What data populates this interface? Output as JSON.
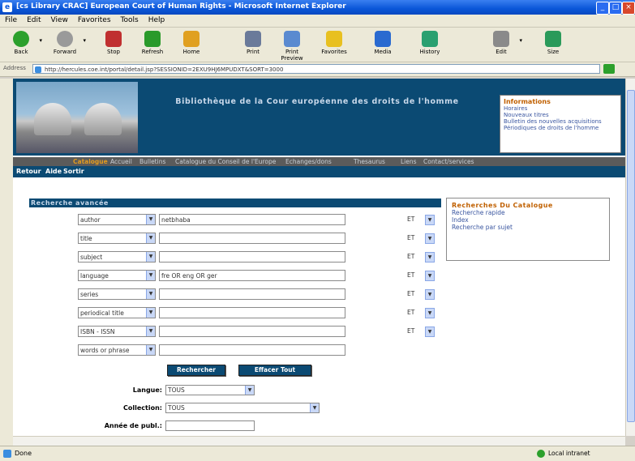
{
  "window": {
    "title": "[cs Library CRAC] European Court of Human Rights - Microsoft Internet Explorer"
  },
  "menu": [
    "File",
    "Edit",
    "View",
    "Favorites",
    "Tools",
    "Help"
  ],
  "toolbar": [
    {
      "label": "Back",
      "icon": "back-icon",
      "color": "#2ca02c"
    },
    {
      "label": "Forward",
      "icon": "forward-icon",
      "color": "#9a9a9a"
    },
    {
      "label": "Stop",
      "icon": "stop-icon",
      "color": "#c03030"
    },
    {
      "label": "Refresh",
      "icon": "refresh-icon",
      "color": "#2a9a2a"
    },
    {
      "label": "Home",
      "icon": "home-icon",
      "color": "#e0a020"
    },
    {
      "label": "Print",
      "icon": "print-icon",
      "color": "#6a7a9a"
    },
    {
      "label": "Print Preview",
      "icon": "print-preview-icon",
      "color": "#5a8ad0"
    },
    {
      "label": "Favorites",
      "icon": "favorites-icon",
      "color": "#e8c020"
    },
    {
      "label": "Media",
      "icon": "media-icon",
      "color": "#2a6ad0"
    },
    {
      "label": "History",
      "icon": "history-icon",
      "color": "#2aa070"
    },
    {
      "label": "Edit",
      "icon": "edit-icon",
      "color": "#8a8a8a"
    },
    {
      "label": "Size",
      "icon": "size-icon",
      "color": "#2a9a5a"
    }
  ],
  "address": {
    "label": "Address",
    "url": "http://hercules.coe.int/portal/detail.jsp?SESSIONID=2EXU9HJ6MPUDXT&SORT=3000"
  },
  "banner": {
    "title": "Bibliothèque de la Cour européenne des droits de l'homme",
    "info_heading": "Informations",
    "info_links": [
      "Horaires",
      "Nouveaux titres",
      "Bulletin des nouvelles acquisitions",
      "Périodiques de droits de l'homme"
    ]
  },
  "nav": {
    "items": [
      "Catalogue",
      "Accueil",
      "Bulletins",
      "Catalogue du Conseil de l'Europe",
      "Echanges/dons",
      "Thesaurus",
      "Liens",
      "Contact/services"
    ],
    "active": "Catalogue"
  },
  "subnav": [
    "Retour",
    "Aide",
    "Sortir"
  ],
  "search": {
    "heading": "Recherche avancée",
    "rows": [
      {
        "field": "author",
        "value": "netbhaba",
        "op": "ET"
      },
      {
        "field": "title",
        "value": "",
        "op": "ET"
      },
      {
        "field": "subject",
        "value": "",
        "op": "ET"
      },
      {
        "field": "language",
        "value": "fre OR eng OR ger",
        "op": "ET"
      },
      {
        "field": "series",
        "value": "",
        "op": "ET"
      },
      {
        "field": "periodical title",
        "value": "",
        "op": "ET"
      },
      {
        "field": "ISBN - ISSN",
        "value": "",
        "op": "ET"
      },
      {
        "field": "words or phrase",
        "value": "",
        "op": ""
      }
    ],
    "search_button": "Rechercher",
    "clear_button": "Effacer Tout",
    "language_label": "Langue:",
    "language_value": "TOUS",
    "collection_label": "Collection:",
    "collection_value": "TOUS",
    "year_label": "Année de publ.:",
    "year_value": ""
  },
  "catalog_box": {
    "heading": "Recherches Du Catalogue",
    "links": [
      "Recherche rapide",
      "Index",
      "Recherche par sujet"
    ]
  },
  "status": {
    "text": "Done",
    "zone": "Local intranet"
  }
}
